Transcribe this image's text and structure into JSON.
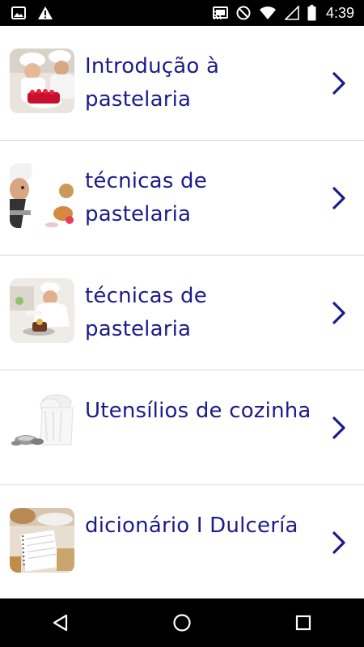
{
  "status_bar": {
    "time": "4:39",
    "icons": [
      "image-icon",
      "warning-icon",
      "cast-icon",
      "do-not-disturb-icon",
      "wifi-icon",
      "signal-icon",
      "battery-icon"
    ]
  },
  "items": [
    {
      "label": "Introdução à pastelaria",
      "icon": "chef-cake-thumbnail"
    },
    {
      "label": "técnicas de pastelaria",
      "icon": "chef-peek-thumbnail"
    },
    {
      "label": "técnicas de pastelaria",
      "icon": "chef-decorating-thumbnail"
    },
    {
      "label": "Utensílios de cozinha",
      "icon": "chef-hat-thumbnail"
    },
    {
      "label": "dicionário I Dulcería",
      "icon": "notebook-flour-thumbnail"
    }
  ],
  "colors": {
    "accent": "#1d1a8a",
    "divider": "#d6d6d6",
    "bars": "#000000"
  },
  "nav_bar": {
    "icons": [
      "back-icon",
      "home-icon",
      "recents-icon"
    ]
  }
}
